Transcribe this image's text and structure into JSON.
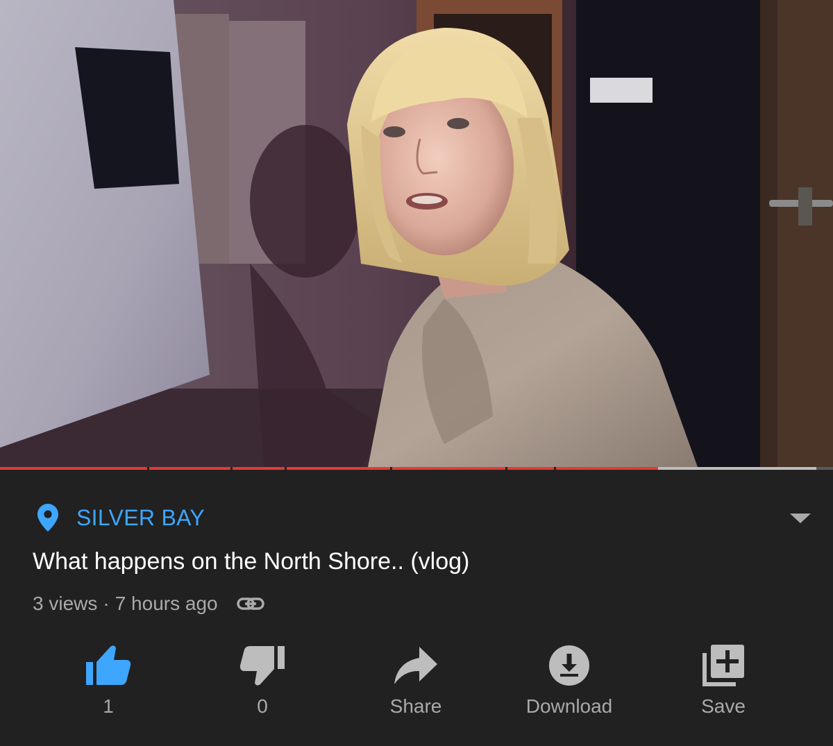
{
  "colors": {
    "background": "#212121",
    "accent_blue": "#3ea6ff",
    "progress_red": "#e53935",
    "secondary_text": "#aaaaaa",
    "icon_gray": "#bdbdbd"
  },
  "player": {
    "progress_played": 0.79,
    "progress_buffered": 0.98
  },
  "location": {
    "icon": "map-pin-icon",
    "label": "SILVER BAY"
  },
  "expand_icon": "chevron-down-icon",
  "video": {
    "title": "What happens on the North Shore.. (vlog)",
    "views": "3 views",
    "separator": "·",
    "age": "7 hours ago",
    "link_icon": "link-icon"
  },
  "actions": {
    "like": {
      "icon": "thumbs-up-icon",
      "label": "1"
    },
    "dislike": {
      "icon": "thumbs-down-icon",
      "label": "0"
    },
    "share": {
      "icon": "share-arrow-icon",
      "label": "Share"
    },
    "download": {
      "icon": "download-icon",
      "label": "Download"
    },
    "save": {
      "icon": "add-to-playlist-icon",
      "label": "Save"
    }
  }
}
